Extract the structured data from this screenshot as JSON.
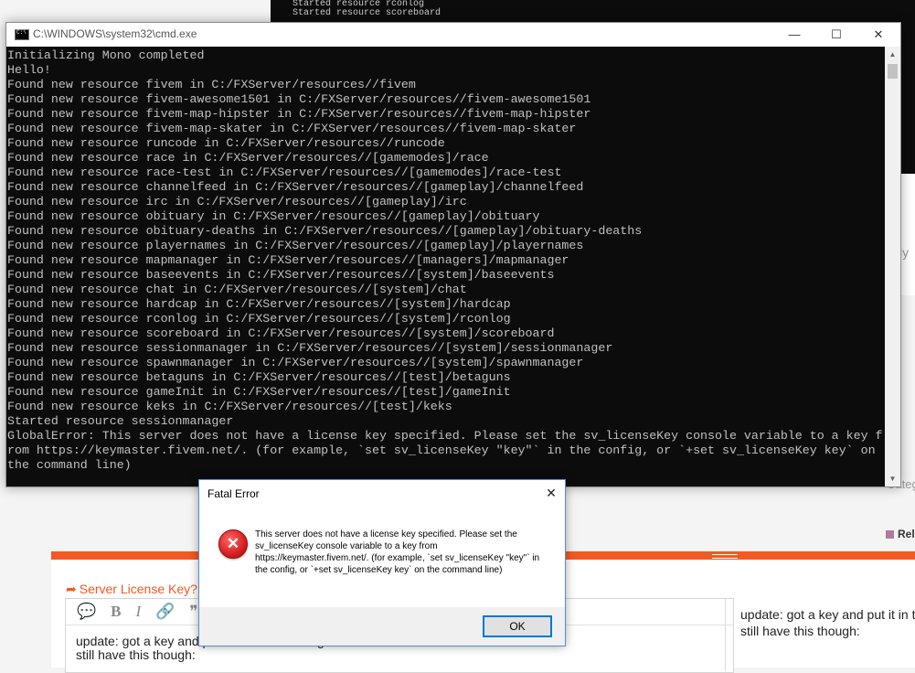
{
  "background": {
    "console_lines": [
      "Started resource rconlog",
      "Started resource scoreboard"
    ],
    "side_fragment_ly": "ly",
    "side_fragment_categ": "Categ",
    "side_fragment_rel": "Rel",
    "forum": {
      "topic_title": "Server License Key?",
      "toolbar": {
        "speech": "💬",
        "bold": "B",
        "italic": "I",
        "link": "🔗",
        "quote": "❞"
      },
      "editor_text_line1": "update: got a key and put it in the server.cfg",
      "editor_text_line2": "still have this though:",
      "preview_text_line1": "update: got a key and put it in the",
      "preview_text_line2": "still have this though:"
    }
  },
  "cmd_window": {
    "title": "C:\\WINDOWS\\system32\\cmd.exe",
    "minimize": "—",
    "maximize": "☐",
    "close": "✕",
    "lines": [
      "Initializing Mono completed",
      "Hello!",
      "Found new resource fivem in C:/FXServer/resources//fivem",
      "Found new resource fivem-awesome1501 in C:/FXServer/resources//fivem-awesome1501",
      "Found new resource fivem-map-hipster in C:/FXServer/resources//fivem-map-hipster",
      "Found new resource fivem-map-skater in C:/FXServer/resources//fivem-map-skater",
      "Found new resource runcode in C:/FXServer/resources//runcode",
      "Found new resource race in C:/FXServer/resources//[gamemodes]/race",
      "Found new resource race-test in C:/FXServer/resources//[gamemodes]/race-test",
      "Found new resource channelfeed in C:/FXServer/resources//[gameplay]/channelfeed",
      "Found new resource irc in C:/FXServer/resources//[gameplay]/irc",
      "Found new resource obituary in C:/FXServer/resources//[gameplay]/obituary",
      "Found new resource obituary-deaths in C:/FXServer/resources//[gameplay]/obituary-deaths",
      "Found new resource playernames in C:/FXServer/resources//[gameplay]/playernames",
      "Found new resource mapmanager in C:/FXServer/resources//[managers]/mapmanager",
      "Found new resource baseevents in C:/FXServer/resources//[system]/baseevents",
      "Found new resource chat in C:/FXServer/resources//[system]/chat",
      "Found new resource hardcap in C:/FXServer/resources//[system]/hardcap",
      "Found new resource rconlog in C:/FXServer/resources//[system]/rconlog",
      "Found new resource scoreboard in C:/FXServer/resources//[system]/scoreboard",
      "Found new resource sessionmanager in C:/FXServer/resources//[system]/sessionmanager",
      "Found new resource spawnmanager in C:/FXServer/resources//[system]/spawnmanager",
      "Found new resource betaguns in C:/FXServer/resources//[test]/betaguns",
      "Found new resource gameInit in C:/FXServer/resources//[test]/gameInit",
      "Found new resource keks in C:/FXServer/resources//[test]/keks",
      "Started resource sessionmanager",
      "GlobalError: This server does not have a license key specified. Please set the sv_licenseKey console variable to a key f",
      "rom https://keymaster.fivem.net/. (for example, `set sv_licenseKey \"key\"` in the config, or `+set sv_licenseKey key` on",
      "the command line)"
    ],
    "scroll_up": "▲",
    "scroll_down": "▼"
  },
  "dialog": {
    "title": "Fatal Error",
    "close": "✕",
    "message": "This server does not have a license key specified. Please set the sv_licenseKey console variable to a key from https://keymaster.fivem.net/. (for example, `set sv_licenseKey \"key\"` in the config, or `+set sv_licenseKey key` on the command line)",
    "ok_label": "OK"
  }
}
